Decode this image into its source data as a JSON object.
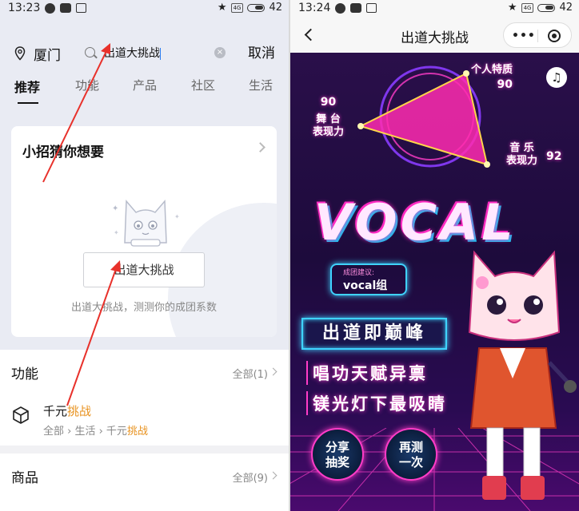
{
  "left": {
    "status": {
      "time": "13:23",
      "battery": "42"
    },
    "location": "厦门",
    "search_query": "出道大挑战",
    "cancel_label": "取消",
    "tabs": [
      "推荐",
      "功能",
      "产品",
      "社区",
      "生活"
    ],
    "card": {
      "title": "小招猜你想要",
      "button_label": "出道大挑战",
      "description": "出道大挑战，测测你的成团系数"
    },
    "functions": {
      "title": "功能",
      "all_label": "全部(1)",
      "item_title_pre": "千元",
      "item_title_hl": "挑战",
      "item_path_pre": "全部 › 生活 › 千元",
      "item_path_hl": "挑战"
    },
    "goods": {
      "title": "商品",
      "all_label": "全部(9)"
    },
    "accent_color": "#e8921f"
  },
  "right": {
    "status": {
      "time": "13:24",
      "battery": "42"
    },
    "page_title": "出道大挑战",
    "stats": {
      "personal_label": "个人特质",
      "personal_value": "90",
      "stage_label_1": "舞 台",
      "stage_label_2": "表现力",
      "stage_value": "90",
      "music_label_1": "音 乐",
      "music_label_2": "表现力",
      "music_value": "92"
    },
    "headline": "VOCAL",
    "suggestion_label": "成团建议:",
    "suggestion_value": "vocal组",
    "slogans": [
      "出道即巅峰",
      "唱功天赋异禀",
      "镁光灯下最吸睛"
    ],
    "buttons": {
      "share": [
        "分享",
        "抽奖"
      ],
      "retry": [
        "再测",
        "一次"
      ]
    },
    "neon_colors": [
      "#ff3cc8",
      "#3fd3ff"
    ]
  }
}
